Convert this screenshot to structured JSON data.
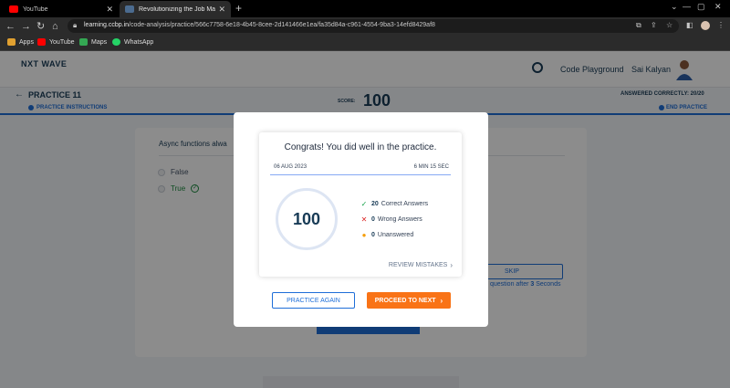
{
  "browser": {
    "tabs": [
      {
        "title": "YouTube",
        "favicon_color": "#ff0000"
      },
      {
        "title": "Revolutionizing the Job Market |",
        "favicon_color": "#4b6b8f"
      }
    ],
    "url_host": "learning.ccbp.in",
    "url_path": "/code-analysis/practice/566c7758-6e18-4b45-8cee-2d141466e1ea/fa35d84a-c961-4554-9ba3-14efd8429af8",
    "bookmarks": [
      {
        "label": "Apps",
        "color": "#e0a030"
      },
      {
        "label": "YouTube",
        "color": "#ff0000"
      },
      {
        "label": "Maps",
        "color": "#34a853"
      },
      {
        "label": "WhatsApp",
        "color": "#25d366"
      }
    ]
  },
  "header": {
    "logo": "NXT WAVE",
    "code_playground": "Code Playground",
    "user_name": "Sai Kalyan"
  },
  "practice": {
    "title": "PRACTICE 11",
    "instructions": "PRACTICE INSTRUCTIONS",
    "score_label": "SCORE:",
    "score_value": "100",
    "answered": "ANSWERED CORRECTLY: 20/20",
    "end": "END PRACTICE",
    "question": "Async functions alwa",
    "options": [
      "False",
      "True"
    ],
    "skip": "SKIP",
    "skip_note_prefix": "question after ",
    "skip_note_num": "3",
    "skip_note_suffix": " Seconds"
  },
  "modal": {
    "congrats": "Congrats! You did well in the practice.",
    "date": "06 AUG 2023",
    "duration": "6 MIN 15 SEC",
    "score": "100",
    "correct_count": "20",
    "correct_label": "Correct Answers",
    "wrong_count": "0",
    "wrong_label": "Wrong Answers",
    "unanswered_count": "0",
    "unanswered_label": "Unanswered",
    "review": "REVIEW MISTAKES",
    "practice_again": "PRACTICE AGAIN",
    "proceed": "PROCEED TO NEXT"
  },
  "colors": {
    "primary": "#1e6ed8",
    "accent": "#f97316",
    "correct": "#16a34a",
    "wrong": "#dc2626",
    "unanswered": "#f59e0b"
  }
}
